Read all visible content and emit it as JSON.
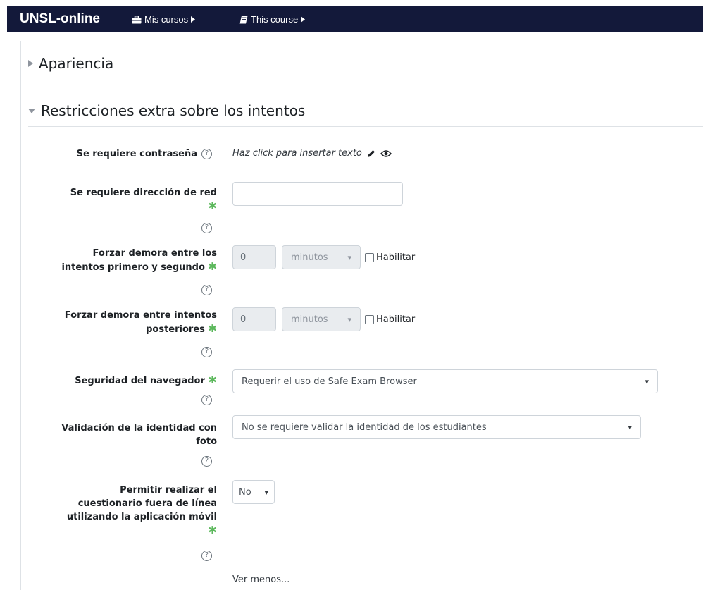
{
  "nav": {
    "brand": "UNSL-online",
    "items": [
      {
        "label": "Mis cursos",
        "icon": "briefcase-icon"
      },
      {
        "label": "This course",
        "icon": "book-icon"
      }
    ]
  },
  "sections": {
    "appearance": "Apariencia",
    "restrictions": "Restricciones extra sobre los intentos"
  },
  "fields": {
    "password": {
      "label": "Se requiere contraseña",
      "value": "Haz click para insertar texto"
    },
    "network": {
      "label_line1": "Se requiere dirección de red",
      "value": ""
    },
    "delay1": {
      "label_line1": "Forzar demora entre los",
      "label_line2": "intentos primero y segundo",
      "value": "0",
      "unit": "minutos",
      "enable_label": "Habilitar"
    },
    "delay2": {
      "label_line1": "Forzar demora entre intentos",
      "label_line2": "posteriores",
      "value": "0",
      "unit": "minutos",
      "enable_label": "Habilitar"
    },
    "browser": {
      "label": "Seguridad del navegador",
      "selected": "Requerir el uso de Safe Exam Browser"
    },
    "photo": {
      "label_line1": "Validación de la identidad con",
      "label_line2": "foto",
      "selected": "No se requiere validar la identidad de los estudiantes"
    },
    "offline": {
      "label_line1": "Permitir realizar el",
      "label_line2": "cuestionario fuera de línea",
      "label_line3": "utilizando la aplicación móvil",
      "selected": "No"
    }
  },
  "show_less": "Ver menos...",
  "required_marker": "✱",
  "colors": {
    "navbar": "#13193a",
    "required": "#5cb85c"
  }
}
